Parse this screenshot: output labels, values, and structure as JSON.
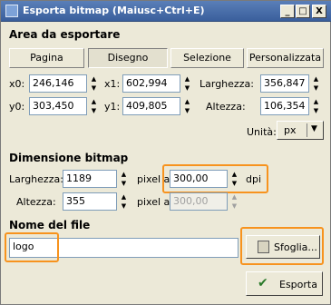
{
  "window": {
    "title": "Esporta bitmap (Maiusc+Ctrl+E)",
    "min_glyph": "_",
    "max_glyph": "□",
    "close_glyph": "X"
  },
  "area": {
    "heading": "Area da esportare",
    "tabs": [
      {
        "label": "Pagina"
      },
      {
        "label": "Disegno"
      },
      {
        "label": "Selezione"
      },
      {
        "label": "Personalizzata"
      }
    ],
    "active_tab": "Disegno",
    "x0_label": "x0:",
    "x0": "246,146",
    "x1_label": "x1:",
    "x1": "602,994",
    "larghezza_label": "Larghezza:",
    "larghezza": "356,847",
    "y0_label": "y0:",
    "y0": "303,450",
    "y1_label": "y1:",
    "y1": "409,805",
    "altezza_label": "Altezza:",
    "altezza": "106,354",
    "unit_label": "Unità:",
    "unit": "px"
  },
  "bitmap": {
    "heading": "Dimensione bitmap",
    "width_label": "Larghezza:",
    "width": "1189",
    "pixel_at_label_1": "pixel a",
    "dpi_x": "300,00",
    "dpi_label": "dpi",
    "height_label": "Altezza:",
    "height": "355",
    "pixel_at_label_2": "pixel a",
    "dpi_y": "300,00"
  },
  "file": {
    "heading": "Nome del file",
    "filename": "logo",
    "browse_label": "Sfoglia..."
  },
  "export_label": "Esporta",
  "highlight_color": "#f7931e"
}
